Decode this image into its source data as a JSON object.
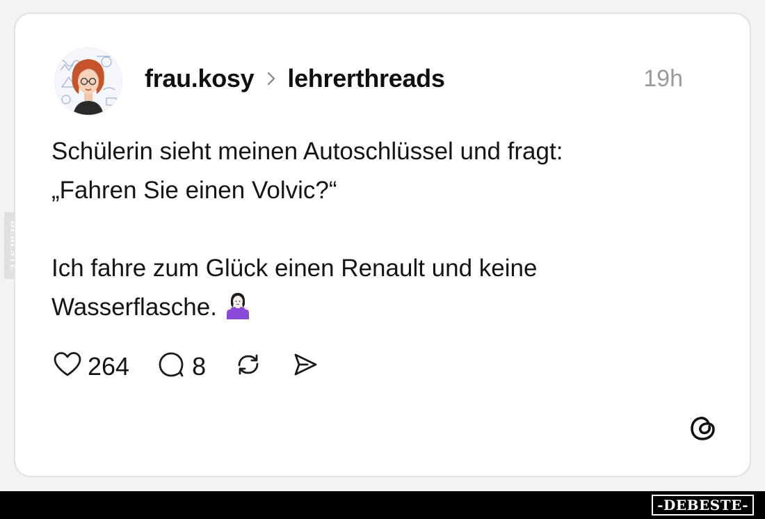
{
  "post": {
    "author": "frau.kosy",
    "community": "lehrerthreads",
    "time": "19h",
    "text": {
      "line1": "Schülerin sieht meinen Autoschlüssel und fragt:",
      "line2": "„Fahren Sie einen Volvic?“",
      "line3": "Ich fahre zum Glück einen Renault und keine",
      "line4": "Wasserflasche."
    },
    "emoji": "person-shrugging-emoji",
    "likes": "264",
    "replies": "8"
  },
  "icons": {
    "like": "heart-icon",
    "reply": "speech-bubble-icon",
    "repost": "repost-arrows-icon",
    "share": "send-icon",
    "brand": "threads-logo-icon"
  },
  "watermark": {
    "side": "DEBESTE",
    "bottom": "-DEBESTE-"
  },
  "colors": {
    "background": "#f3f3f3",
    "card": "#ffffff",
    "text": "#141414",
    "muted": "#9a9a9a",
    "emoji_shirt": "#8a49d9"
  }
}
